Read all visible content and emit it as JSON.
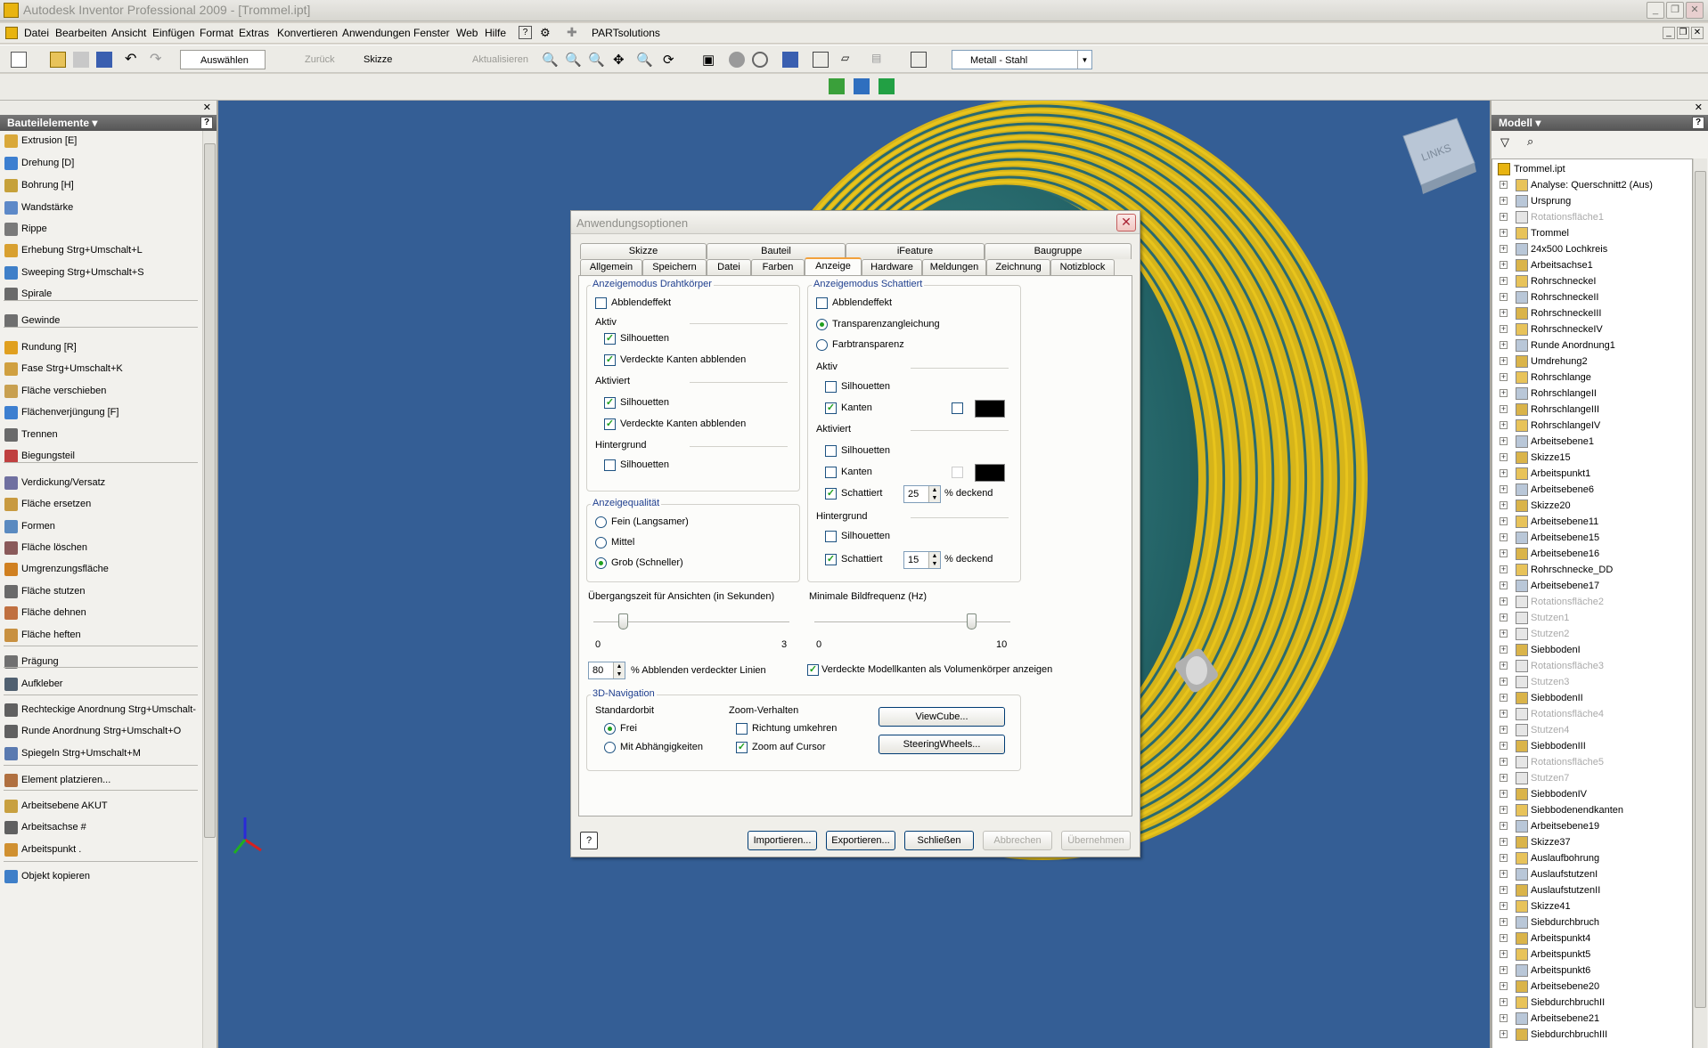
{
  "window": {
    "title": "Autodesk Inventor Professional 2009 - [Trommel.ipt]"
  },
  "menu": [
    "Datei",
    "Bearbeiten",
    "Ansicht",
    "Einfügen",
    "Format",
    "Extras",
    "Konvertieren",
    "Anwendungen",
    "Fenster",
    "Web",
    "Hilfe",
    "PARTsolutions"
  ],
  "toolbar": {
    "select": "Auswählen",
    "back": "Zurück",
    "sketch": "Skizze",
    "update": "Aktualisieren",
    "material": "Metall - Stahl"
  },
  "left_panel": {
    "title": "Bauteilelemente",
    "items": [
      "Extrusion    [E]",
      "Drehung    [D]",
      "Bohrung    [H]",
      "Wandstärke",
      "Rippe",
      "Erhebung    Strg+Umschalt+L",
      "Sweeping    Strg+Umschalt+S",
      "Spirale",
      "Gewinde",
      "Rundung    [R]",
      "Fase    Strg+Umschalt+K",
      "Fläche verschieben",
      "Flächenverjüngung    [F]",
      "Trennen",
      "Biegungsteil",
      "Verdickung/Versatz",
      "Fläche ersetzen",
      "Formen",
      "Fläche löschen",
      "Umgrenzungsfläche",
      "Fläche stutzen",
      "Fläche dehnen",
      "Fläche heften",
      "Prägung",
      "Aufkleber",
      "Rechteckige Anordnung    Strg+Umschalt-",
      "Runde Anordnung    Strg+Umschalt+O",
      "Spiegeln    Strg+Umschalt+M",
      "Element platzieren...",
      "Arbeitsebene    AKUT",
      "Arbeitsachse    #",
      "Arbeitspunkt    .",
      "Objekt kopieren"
    ]
  },
  "viewcube": {
    "label": "LINKS"
  },
  "right_panel": {
    "title": "Modell",
    "root": "Trommel.ipt",
    "items": [
      {
        "label": "Analyse: Querschnitt2 (Aus)",
        "dim": false
      },
      {
        "label": "Ursprung",
        "dim": false
      },
      {
        "label": "Rotationsfläche1",
        "dim": true
      },
      {
        "label": "Trommel",
        "dim": false
      },
      {
        "label": "24x500 Lochkreis",
        "dim": false
      },
      {
        "label": "Arbeitsachse1",
        "dim": false
      },
      {
        "label": "RohrschneckeI",
        "dim": false
      },
      {
        "label": "RohrschneckeII",
        "dim": false
      },
      {
        "label": "RohrschneckeIII",
        "dim": false
      },
      {
        "label": "RohrschneckeIV",
        "dim": false
      },
      {
        "label": "Runde Anordnung1",
        "dim": false
      },
      {
        "label": "Umdrehung2",
        "dim": false
      },
      {
        "label": "Rohrschlange",
        "dim": false
      },
      {
        "label": "RohrschlangeII",
        "dim": false
      },
      {
        "label": "RohrschlangeIII",
        "dim": false
      },
      {
        "label": "RohrschlangeIV",
        "dim": false
      },
      {
        "label": "Arbeitsebene1",
        "dim": false
      },
      {
        "label": "Skizze15",
        "dim": false
      },
      {
        "label": "Arbeitspunkt1",
        "dim": false
      },
      {
        "label": "Arbeitsebene6",
        "dim": false
      },
      {
        "label": "Skizze20",
        "dim": false
      },
      {
        "label": "Arbeitsebene11",
        "dim": false
      },
      {
        "label": "Arbeitsebene15",
        "dim": false
      },
      {
        "label": "Arbeitsebene16",
        "dim": false
      },
      {
        "label": "Rohrschnecke_DD",
        "dim": false
      },
      {
        "label": "Arbeitsebene17",
        "dim": false
      },
      {
        "label": "Rotationsfläche2",
        "dim": true
      },
      {
        "label": "Stutzen1",
        "dim": true
      },
      {
        "label": "Stutzen2",
        "dim": true
      },
      {
        "label": "SiebbodenI",
        "dim": false
      },
      {
        "label": "Rotationsfläche3",
        "dim": true
      },
      {
        "label": "Stutzen3",
        "dim": true
      },
      {
        "label": "SiebbodenII",
        "dim": false
      },
      {
        "label": "Rotationsfläche4",
        "dim": true
      },
      {
        "label": "Stutzen4",
        "dim": true
      },
      {
        "label": "SiebbodenIII",
        "dim": false
      },
      {
        "label": "Rotationsfläche5",
        "dim": true
      },
      {
        "label": "Stutzen7",
        "dim": true
      },
      {
        "label": "SiebbodenIV",
        "dim": false
      },
      {
        "label": "Siebbodenendkanten",
        "dim": false
      },
      {
        "label": "Arbeitsebene19",
        "dim": false
      },
      {
        "label": "Skizze37",
        "dim": false
      },
      {
        "label": "Auslaufbohrung",
        "dim": false
      },
      {
        "label": "AuslaufstutzenI",
        "dim": false
      },
      {
        "label": "AuslaufstutzenII",
        "dim": false
      },
      {
        "label": "Skizze41",
        "dim": false
      },
      {
        "label": "Siebdurchbruch",
        "dim": false
      },
      {
        "label": "Arbeitspunkt4",
        "dim": false
      },
      {
        "label": "Arbeitspunkt5",
        "dim": false
      },
      {
        "label": "Arbeitspunkt6",
        "dim": false
      },
      {
        "label": "Arbeitsebene20",
        "dim": false
      },
      {
        "label": "SiebdurchbruchII",
        "dim": false
      },
      {
        "label": "Arbeitsebene21",
        "dim": false
      },
      {
        "label": "SiebdurchbruchIII",
        "dim": false
      }
    ]
  },
  "dialog": {
    "title": "Anwendungsoptionen",
    "tabs_top": [
      "Skizze",
      "Bauteil",
      "iFeature",
      "Baugruppe"
    ],
    "tabs_bottom": [
      "Allgemein",
      "Speichern",
      "Datei",
      "Farben",
      "Anzeige",
      "Hardware",
      "Meldungen",
      "Zeichnung",
      "Notizblock"
    ],
    "wire": {
      "title": "Anzeigemodus Drahtkörper",
      "dim": "Abblendeffekt",
      "aktiv": "Aktiv",
      "aktiviert": "Aktiviert",
      "hintergrund": "Hintergrund",
      "sil": "Silhouetten",
      "hidden": "Verdeckte Kanten abblenden"
    },
    "shaded": {
      "title": "Anzeigemodus Schattiert",
      "dim": "Abblendeffekt",
      "transp": "Transparenzangleichung",
      "farbtransp": "Farbtransparenz",
      "aktiv": "Aktiv",
      "aktiviert": "Aktiviert",
      "hintergrund": "Hintergrund",
      "sil": "Silhouetten",
      "kanten": "Kanten",
      "schattiert": "Schattiert",
      "pct1": "25",
      "pct2": "15",
      "deckend": "% deckend"
    },
    "quality": {
      "title": "Anzeigequalität",
      "fein": "Fein (Langsamer)",
      "mittel": "Mittel",
      "grob": "Grob (Schneller)"
    },
    "transition": {
      "label": "Übergangszeit für Ansichten (in Sekunden)",
      "min": "0",
      "max": "3",
      "value": 0.45
    },
    "framerate": {
      "label": "Minimale Bildfrequenz (Hz)",
      "min": "0",
      "max": "10",
      "value": 8
    },
    "hidden_lines": {
      "value": "80",
      "label": "% Abblenden verdeckter Linien"
    },
    "solid_edges": "Verdeckte Modellkanten als Volumenkörper anzeigen",
    "nav": {
      "title": "3D-Navigation",
      "orbit": "Standardorbit",
      "frei": "Frei",
      "abh": "Mit Abhängigkeiten",
      "zoom": "Zoom-Verhalten",
      "reverse": "Richtung umkehren",
      "cursor": "Zoom auf Cursor",
      "viewcube": "ViewCube...",
      "steering": "SteeringWheels..."
    },
    "buttons": {
      "import": "Importieren...",
      "export": "Exportieren...",
      "close": "Schließen",
      "cancel": "Abbrechen",
      "apply": "Übernehmen"
    }
  }
}
